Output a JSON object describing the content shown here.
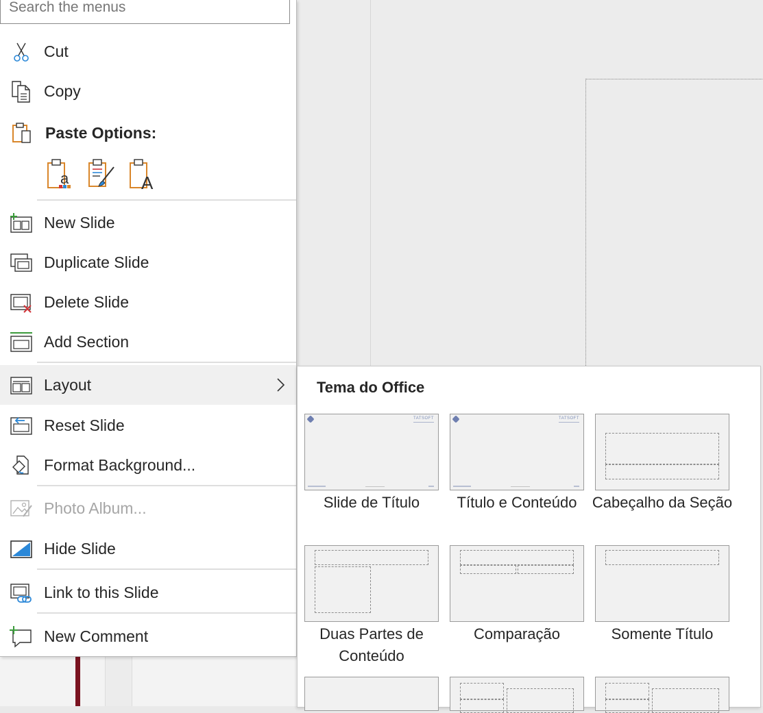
{
  "search": {
    "placeholder": "Search the menus"
  },
  "menu": {
    "items": [
      {
        "label": "Cut",
        "icon": "scissors-icon"
      },
      {
        "label": "Copy",
        "icon": "copy-icon"
      },
      {
        "label": "Paste Options:",
        "icon": "clipboard-icon"
      },
      {
        "label": "New Slide",
        "icon": "new-slide-icon"
      },
      {
        "label": "Duplicate Slide",
        "icon": "duplicate-slide-icon"
      },
      {
        "label": "Delete Slide",
        "icon": "delete-slide-icon"
      },
      {
        "label": "Add Section",
        "icon": "add-section-icon"
      },
      {
        "label": "Layout",
        "icon": "layout-icon"
      },
      {
        "label": "Reset Slide",
        "icon": "reset-slide-icon"
      },
      {
        "label": "Format Background...",
        "icon": "format-background-icon"
      },
      {
        "label": "Photo Album...",
        "icon": "photo-album-icon",
        "disabled": true
      },
      {
        "label": "Hide Slide",
        "icon": "hide-slide-icon"
      },
      {
        "label": "Link to this Slide",
        "icon": "link-slide-icon"
      },
      {
        "label": "New Comment",
        "icon": "new-comment-icon"
      }
    ],
    "paste_options": [
      "use-destination-theme-icon",
      "keep-source-formatting-icon",
      "keep-text-only-icon"
    ]
  },
  "gallery": {
    "title": "Tema do Office",
    "brand_text": "TATSOFT",
    "layouts": [
      {
        "name": "Slide de Título"
      },
      {
        "name": "Título e Conteúdo"
      },
      {
        "name": "Cabeçalho da Seção"
      },
      {
        "name": "Duas Partes de Conteúdo"
      },
      {
        "name": "Comparação"
      },
      {
        "name": "Somente Título"
      }
    ]
  },
  "colors": {
    "accent_orange": "#d9862a",
    "accent_blue": "#2b88d8",
    "accent_red": "#d13438",
    "accent_green": "#3a9a3a",
    "menu_hover": "#f0f0f0"
  }
}
